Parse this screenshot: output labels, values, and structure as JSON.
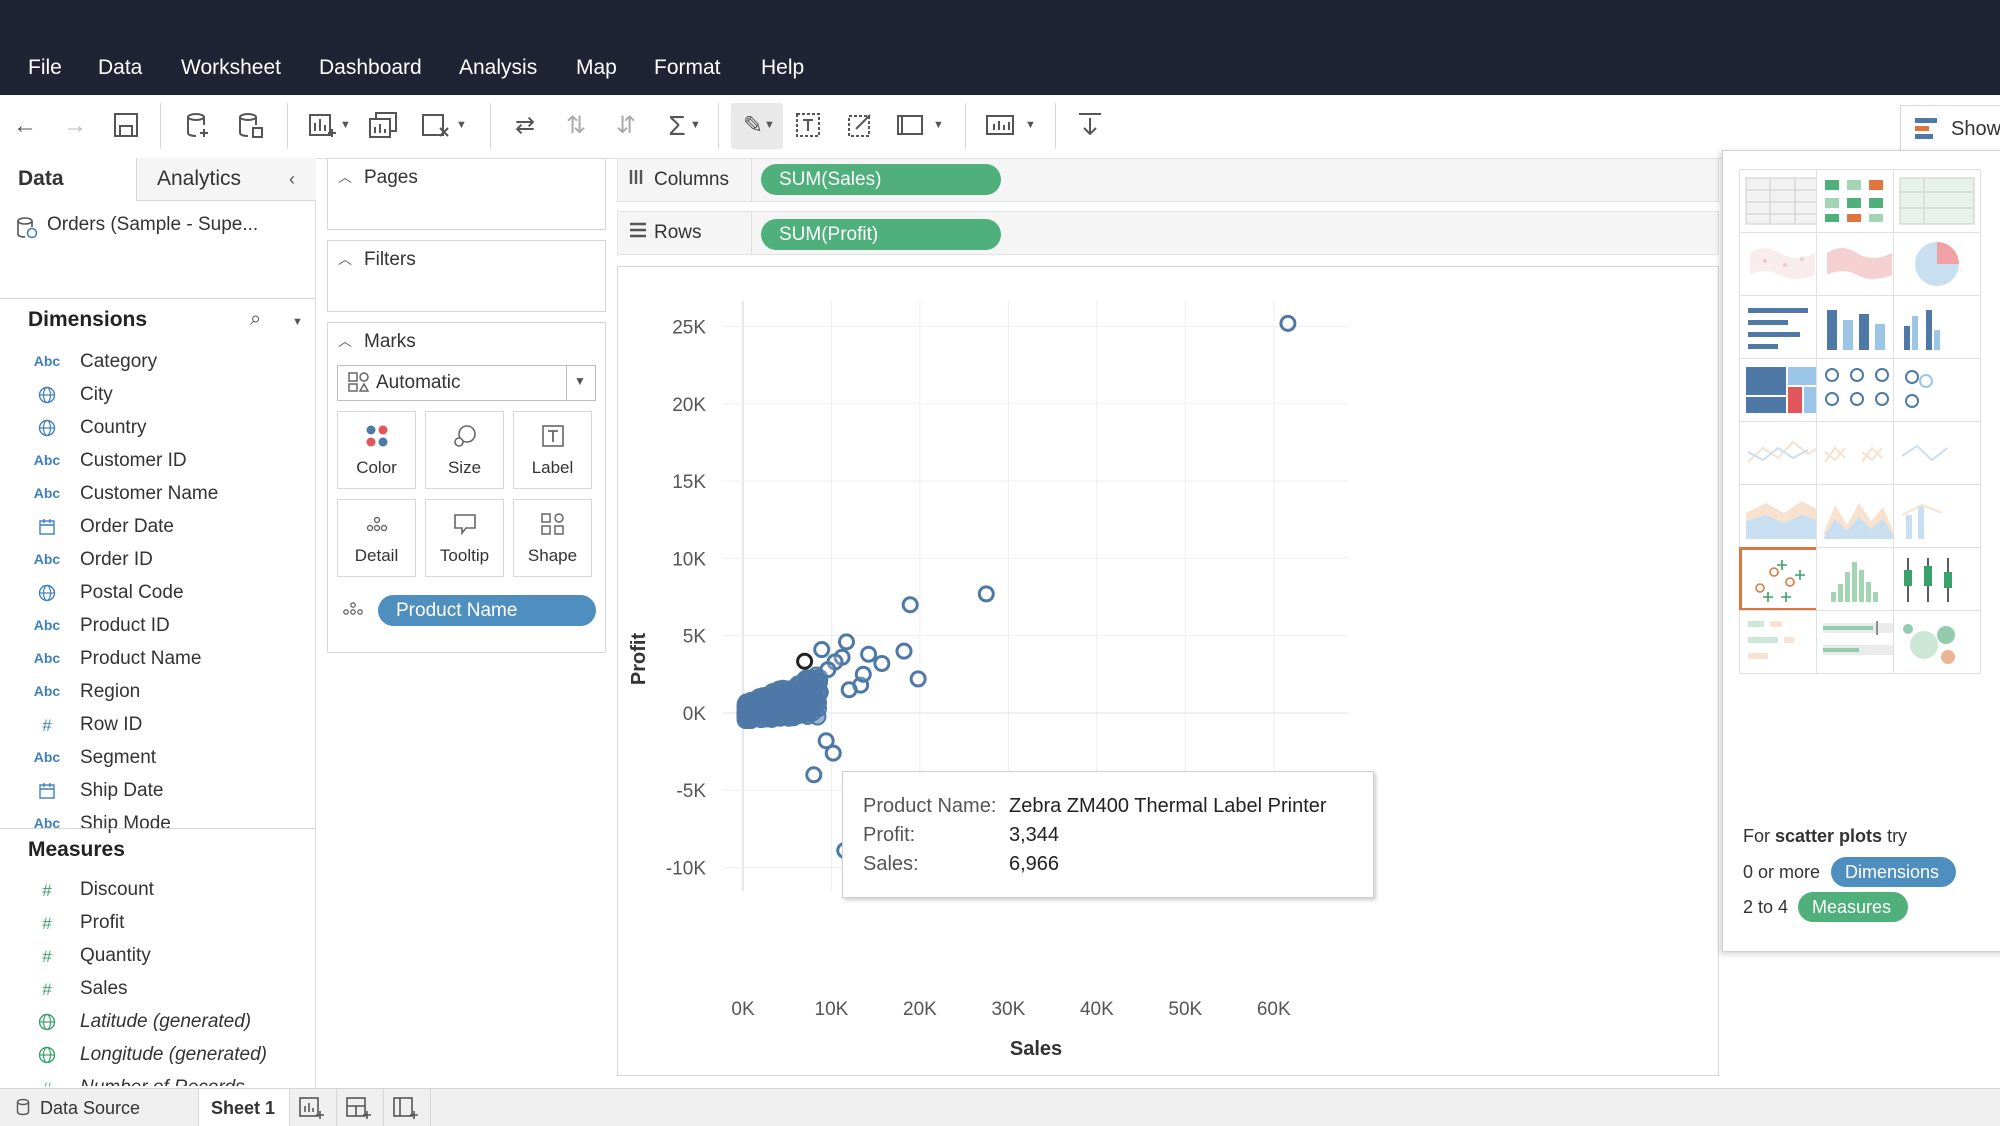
{
  "menu": [
    "File",
    "Data",
    "Worksheet",
    "Dashboard",
    "Analysis",
    "Map",
    "Format",
    "Help"
  ],
  "toolbar": {
    "show_me_label": "Show"
  },
  "datapane": {
    "tabs": [
      "Data",
      "Analytics"
    ],
    "datasource": "Orders (Sample - Supe...",
    "dimensions_label": "Dimensions",
    "dimensions": [
      {
        "type": "Abc",
        "name": "Category"
      },
      {
        "type": "geo",
        "name": "City"
      },
      {
        "type": "geo",
        "name": "Country"
      },
      {
        "type": "Abc",
        "name": "Customer ID"
      },
      {
        "type": "Abc",
        "name": "Customer Name"
      },
      {
        "type": "date",
        "name": "Order Date"
      },
      {
        "type": "Abc",
        "name": "Order ID"
      },
      {
        "type": "geo",
        "name": "Postal Code"
      },
      {
        "type": "Abc",
        "name": "Product ID"
      },
      {
        "type": "Abc",
        "name": "Product Name"
      },
      {
        "type": "Abc",
        "name": "Region"
      },
      {
        "type": "#",
        "name": "Row ID"
      },
      {
        "type": "Abc",
        "name": "Segment"
      },
      {
        "type": "date",
        "name": "Ship Date"
      },
      {
        "type": "Abc",
        "name": "Ship Mode"
      }
    ],
    "measures_label": "Measures",
    "measures": [
      {
        "type": "#",
        "name": "Discount",
        "italic": false
      },
      {
        "type": "#",
        "name": "Profit",
        "italic": false
      },
      {
        "type": "#",
        "name": "Quantity",
        "italic": false
      },
      {
        "type": "#",
        "name": "Sales",
        "italic": false
      },
      {
        "type": "geo",
        "name": "Latitude (generated)",
        "italic": true
      },
      {
        "type": "geo",
        "name": "Longitude (generated)",
        "italic": true
      },
      {
        "type": "#",
        "name": "Number of Records",
        "italic": true
      }
    ]
  },
  "cards": {
    "pages": "Pages",
    "filters": "Filters",
    "marks": "Marks",
    "mark_type": "Automatic",
    "buttons": [
      "Color",
      "Size",
      "Label",
      "Detail",
      "Tooltip",
      "Shape"
    ],
    "detail_pill": "Product Name"
  },
  "shelves": {
    "columns_label": "Columns",
    "columns_pill": "SUM(Sales)",
    "rows_label": "Rows",
    "rows_pill": "SUM(Profit)"
  },
  "chart_data": {
    "type": "scatter",
    "xlabel": "Sales",
    "ylabel": "Profit",
    "xlim": [
      0,
      65000
    ],
    "ylim": [
      -11000,
      26000
    ],
    "x_ticks": [
      0,
      10000,
      20000,
      30000,
      40000,
      50000,
      60000
    ],
    "x_tick_labels": [
      "0K",
      "10K",
      "20K",
      "30K",
      "40K",
      "50K",
      "60K"
    ],
    "y_ticks": [
      -10000,
      -5000,
      0,
      5000,
      10000,
      15000,
      20000,
      25000
    ],
    "y_tick_labels": [
      "-10K",
      "-5K",
      "0K",
      "5K",
      "10K",
      "15K",
      "20K",
      "25K"
    ],
    "grid": true,
    "mark_color": "#4e79a7",
    "points": [
      [
        61600,
        25200
      ],
      [
        27500,
        7700
      ],
      [
        18900,
        7000
      ],
      [
        18200,
        4000
      ],
      [
        19800,
        2200
      ],
      [
        11700,
        4600
      ],
      [
        11200,
        3600
      ],
      [
        10400,
        3300
      ],
      [
        14200,
        3800
      ],
      [
        15700,
        3200
      ],
      [
        8900,
        4100
      ],
      [
        9600,
        2800
      ],
      [
        6966,
        3344
      ],
      [
        13300,
        1800
      ],
      [
        12000,
        1500
      ],
      [
        13600,
        2500
      ],
      [
        8000,
        -4000
      ],
      [
        11500,
        -8900
      ],
      [
        9400,
        -1800
      ],
      [
        10200,
        -2600
      ]
    ],
    "cluster": {
      "x_range": [
        0,
        9000
      ],
      "y_range": [
        -1600,
        2800
      ]
    },
    "highlight_index": 12
  },
  "tooltip": {
    "product_key": "Product Name:",
    "product_val": "Zebra ZM400 Thermal Label Printer",
    "profit_key": "Profit:",
    "profit_val": "3,344",
    "sales_key": "Sales:",
    "sales_val": "6,966"
  },
  "showme": {
    "hint_prefix": "For ",
    "hint_bold": "scatter plots",
    "hint_suffix": " try",
    "dim_prefix": "0 or more",
    "dim_pill": "Dimensions",
    "meas_prefix": "2 to 4",
    "meas_pill": "Measures"
  },
  "bottom": {
    "datasource": "Data Source",
    "sheet": "Sheet 1"
  }
}
